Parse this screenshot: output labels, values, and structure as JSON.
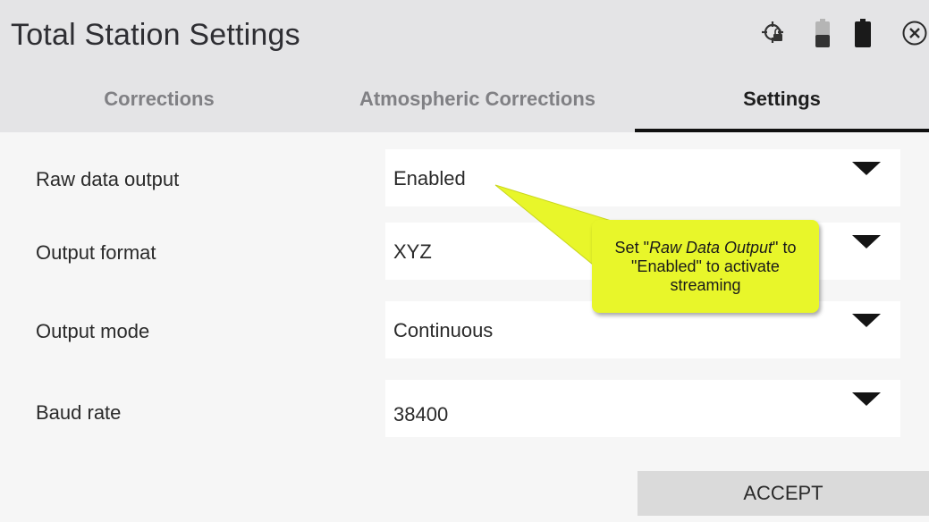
{
  "header": {
    "title": "Total Station Settings",
    "icons": [
      "gps-lock-icon",
      "battery-low-icon",
      "battery-full-icon",
      "close-icon"
    ]
  },
  "tabs": [
    {
      "label": "Corrections",
      "active": false
    },
    {
      "label": "Atmospheric Corrections",
      "active": false
    },
    {
      "label": "Settings",
      "active": true
    }
  ],
  "settings": [
    {
      "label": "Raw data output",
      "value": "Enabled"
    },
    {
      "label": "Output format",
      "value": "XYZ"
    },
    {
      "label": "Output mode",
      "value": "Continuous"
    },
    {
      "label": "Baud rate",
      "value": "38400"
    }
  ],
  "accept_label": "ACCEPT",
  "callout": {
    "part1": "Set \"",
    "emphasis": "Raw Data Output",
    "part2": "\" to \"Enabled\" to activate streaming"
  },
  "colors": {
    "header_bg": "#e4e4e6",
    "callout_bg": "#e8f62a",
    "active_tab_underline": "#111111",
    "accept_bg": "#dadada"
  }
}
